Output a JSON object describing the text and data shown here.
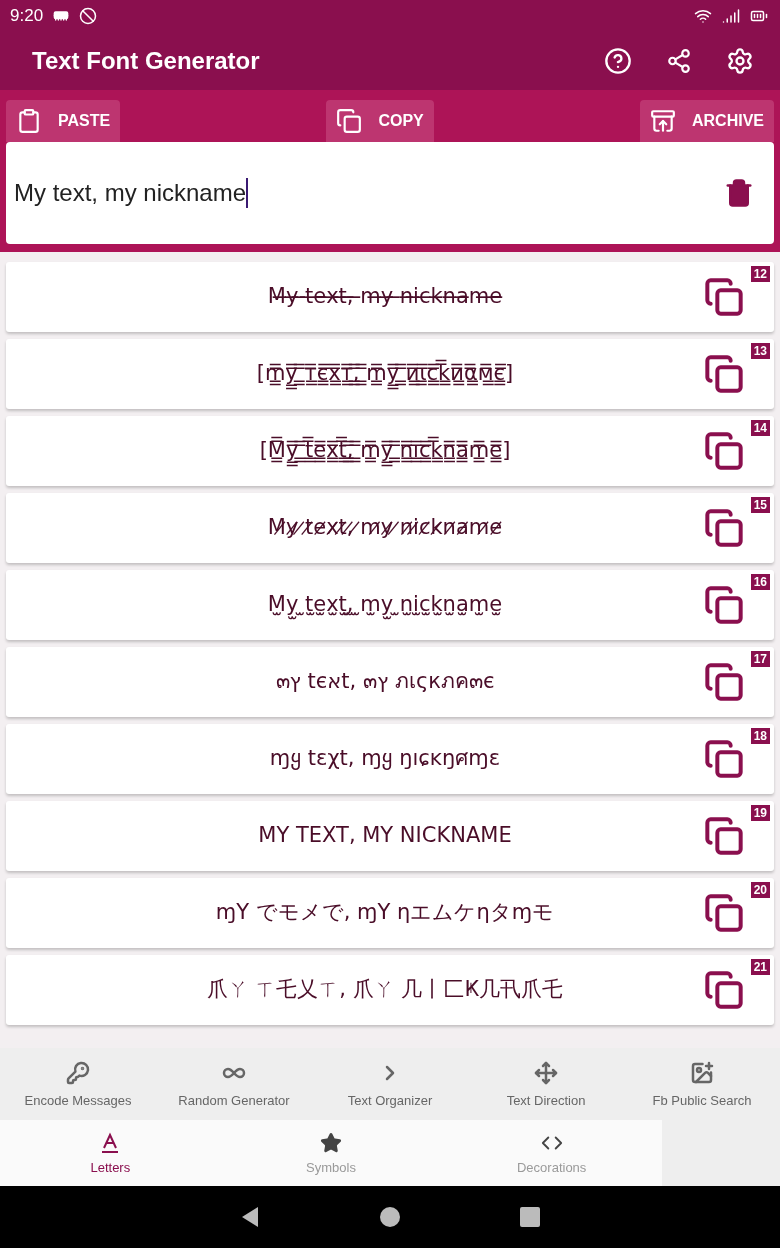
{
  "status_bar": {
    "time": "9:20"
  },
  "app_bar": {
    "title": "Text Font Generator"
  },
  "toolbar": {
    "buttons": [
      {
        "kind": "paste",
        "label": "PASTE"
      },
      {
        "kind": "copy",
        "label": "COPY"
      },
      {
        "kind": "archive",
        "label": "ARCHIVE"
      }
    ]
  },
  "input": {
    "value": "My text, my nickname"
  },
  "results": [
    {
      "number": "12",
      "text": "M̶y̶ ̶t̶e̶x̶t̶,̶ ̶m̶y̶ ̶n̶i̶c̶k̶n̶a̶m̶e̶"
    },
    {
      "number": "13",
      "text": "[m̳̿y̳̿ ̳̿т̳̿є̳̿х̳̿т̳̿,̳̿ ̳̿m̳̿y̳̿ ̳̿и̳̿ι̳̿c̳̿k̳̿и̳̿α̳̿м̳̿є̳̿]"
    },
    {
      "number": "14",
      "text": "[M̳̿y̳̿ ̳̿t̳̿e̳̿x̳̿t̳̿,̳̿ ̳̿m̳̿y̳̿ ̳̿n̳̿i̳̿c̳̿k̳̿n̳̿a̳̿m̳̿e̳̿]"
    },
    {
      "number": "15",
      "text": "M̷y̷ ̷t̷e̷x̷t̷,̷ ̷m̷y̷ ̷n̷i̷c̷k̷n̷a̷m̷e̷"
    },
    {
      "number": "16",
      "text": "M̫y̫ ̫t̫e̫x̫t̫,̫ ̫m̫y̫ ̫n̫i̫c̫k̫n̫a̫m̫e̫"
    },
    {
      "number": "17",
      "text": "๓ץ tєאt, ๓ץ ภเςкภค๓є"
    },
    {
      "number": "18",
      "text": "ɱყ tɛχt, ɱყ ŋıɕĸŋศɱɛ"
    },
    {
      "number": "19",
      "text": "MY TEXT, MY NICKNAME"
    },
    {
      "number": "20",
      "text": "ɱΥ でモメで, ɱΥ ηエムケηタɱモ"
    },
    {
      "number": "21",
      "text": "爪ㄚ ㄒ乇乂ㄒ, 爪ㄚ 几丨匚Ҝ几卂爪乇"
    }
  ],
  "tools": [
    {
      "kind": "key",
      "label": "Encode Messages"
    },
    {
      "kind": "infinity",
      "label": "Random Generator"
    },
    {
      "kind": "organizer",
      "label": "Text Organizer"
    },
    {
      "kind": "move",
      "label": "Text Direction"
    },
    {
      "kind": "image-search",
      "label": "Fb Public Search"
    }
  ],
  "tabs": [
    {
      "kind": "letters",
      "label": "Letters",
      "selected": true
    },
    {
      "kind": "symbols",
      "label": "Symbols",
      "selected": false
    },
    {
      "kind": "decorations",
      "label": "Decorations",
      "selected": false
    }
  ]
}
